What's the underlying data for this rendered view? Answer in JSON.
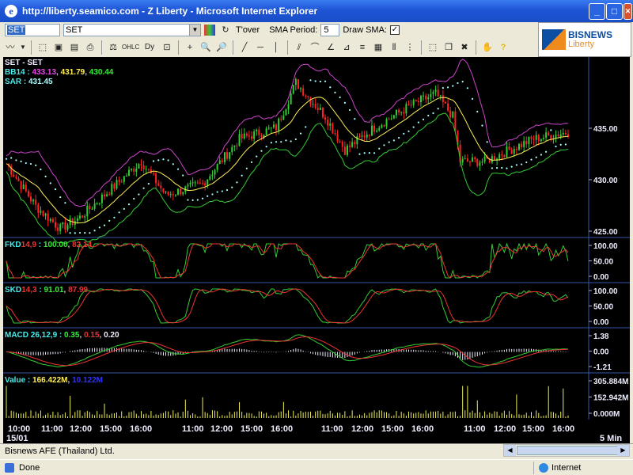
{
  "window": {
    "title": "http://liberty.seamico.com - Z Liberty - Microsoft Internet Explorer"
  },
  "toolbar": {
    "symbol_input": "SET",
    "symbol_combo": "SET",
    "turnover_label": "T'over",
    "sma_label": "SMA Period:",
    "sma_value": "5",
    "draw_sma_label": "Draw SMA:",
    "draw_sma_checked": "✓"
  },
  "logo": {
    "line1": "BISNEWS",
    "line2": "Liberty"
  },
  "overlays": {
    "price_title": "SET - SET",
    "bb_label": "BB14 : ",
    "bb_upper": "433.13",
    "bb_mid": "431.79",
    "bb_lower": "430.44",
    "sar_label": "SAR : ",
    "sar_value": "431.45",
    "fkd_label": "FKD",
    "fkd_params": "14,9",
    "fkd_sep": " : ",
    "fkd_k": "100.00",
    "fkd_d": "82.14",
    "skd_label": "SKD",
    "skd_params": "14,3",
    "skd_sep": " : ",
    "skd_k": "91.01",
    "skd_d": "87.99",
    "macd_label": "MACD 26,12,9 : ",
    "macd_v1": "0.35",
    "macd_v2": "0.15",
    "macd_v3": "0.20",
    "vol_label": "Value : ",
    "vol_v1": "166.422M",
    "vol_v2": "10.122M"
  },
  "colors": {
    "price_up": "#33cc33",
    "price_down": "#ff2222",
    "bb_upper": "#cc44cc",
    "bb_mid": "#ffee55",
    "bb_lower": "#33cc33",
    "sar": "#aaffff",
    "stoch_k": "#33cc33",
    "stoch_d": "#ee3333"
  },
  "chart_data": {
    "type": "line",
    "panels": [
      "price",
      "FKD",
      "SKD",
      "MACD",
      "Value"
    ],
    "price_ticks": [
      "435.00",
      "430.00",
      "425.00"
    ],
    "fkd_ticks": [
      "100.00",
      "50.00",
      "0.00"
    ],
    "skd_ticks": [
      "100.00",
      "50.00",
      "0.00"
    ],
    "macd_ticks": [
      "1.38",
      "0.00",
      "-1.21"
    ],
    "vol_ticks": [
      "305.884M",
      "152.942M",
      "0.000M"
    ],
    "x_ticks": [
      "10:00",
      "11:00",
      "12:00",
      "15:00",
      "16:00",
      "11:00",
      "12:00",
      "15:00",
      "16:00",
      "11:00",
      "12:00",
      "15:00",
      "16:00",
      "11:00",
      "12:00",
      "15:00",
      "16:00"
    ],
    "date_label": "15/01",
    "interval_label": "5 Min"
  },
  "status": {
    "company": "Bisnews AFE (Thailand) Ltd.",
    "done": "Done",
    "zone": "Internet"
  }
}
